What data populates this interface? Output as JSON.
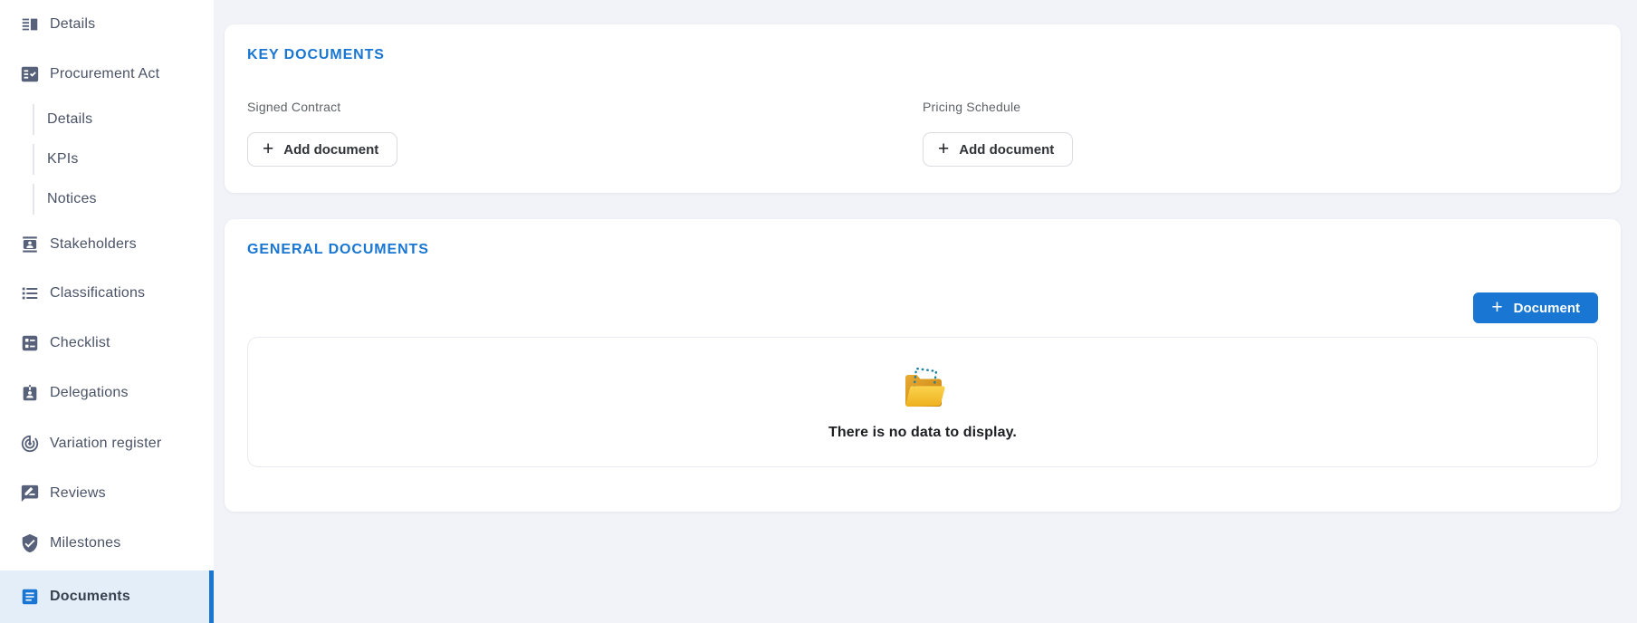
{
  "icons": {
    "plus": "+"
  },
  "colors": {
    "accent_blue": "#1976d2",
    "section_title_blue": "#1976d2",
    "page_background": "#f1f3f8",
    "sidebar_background": "#ffffff",
    "active_item_background": "#e3eef9",
    "sidebar_icon_gray": "#57617a",
    "folder_gold": "#edb01e",
    "folder_dark_gold": "#c9820f",
    "folder_dotted_outline": "#1b7fa0"
  },
  "sidebar": {
    "items": [
      {
        "label": "Details"
      },
      {
        "label": "Procurement Act"
      },
      {
        "label": "Details"
      },
      {
        "label": "KPIs"
      },
      {
        "label": "Notices"
      },
      {
        "label": "Stakeholders"
      },
      {
        "label": "Classifications"
      },
      {
        "label": "Checklist"
      },
      {
        "label": "Delegations"
      },
      {
        "label": "Variation register"
      },
      {
        "label": "Reviews"
      },
      {
        "label": "Milestones"
      },
      {
        "label": "Documents"
      }
    ]
  },
  "key_documents": {
    "title": "KEY DOCUMENTS",
    "slots": [
      {
        "label": "Signed Contract",
        "button_label": "Add document"
      },
      {
        "label": "Pricing Schedule",
        "button_label": "Add document"
      }
    ]
  },
  "general_documents": {
    "title": "GENERAL DOCUMENTS",
    "add_button_label": "Document",
    "empty_message": "There is no data to display."
  }
}
